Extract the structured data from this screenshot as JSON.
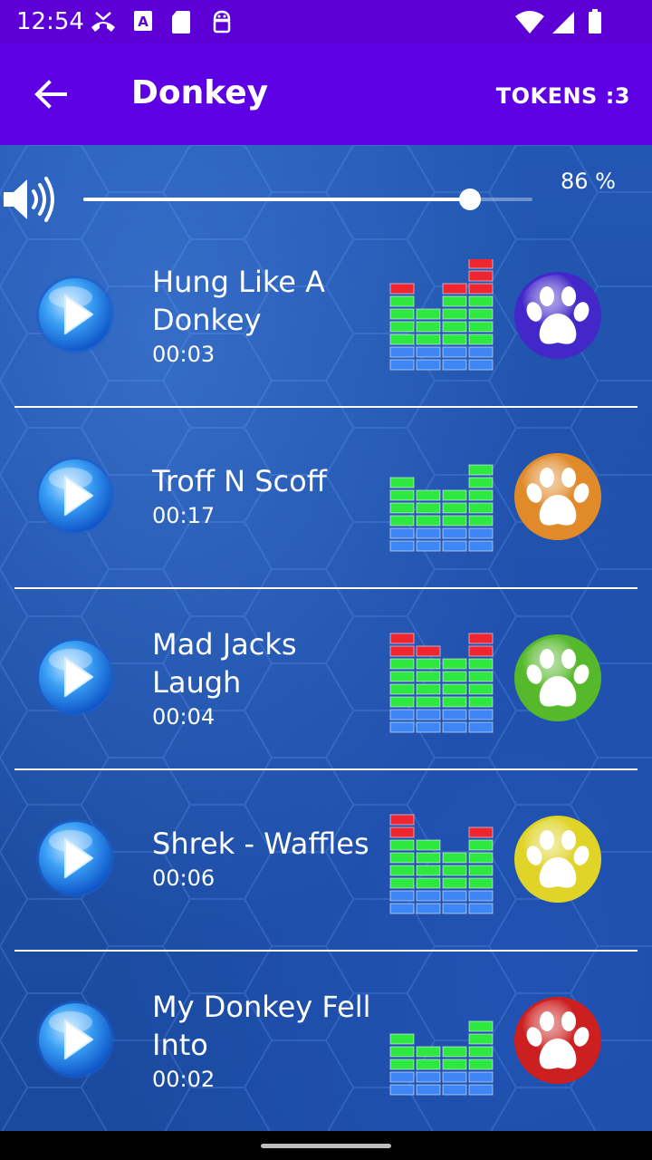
{
  "status": {
    "time": "12:54",
    "icons": [
      "missed-call-icon",
      "text-a-icon",
      "sd-card-icon",
      "android-icon"
    ],
    "right_icons": [
      "wifi-icon",
      "signal-icon",
      "battery-icon"
    ]
  },
  "app_bar": {
    "title": "Donkey",
    "tokens": "TOKENS :3",
    "back_icon": "arrow-back-icon",
    "color": "#5d00e3"
  },
  "volume": {
    "percent_label": "86 %",
    "level": 0.86,
    "icon": "speaker-icon"
  },
  "sounds": [
    {
      "title": "Hung Like A Donkey",
      "duration": "00:03",
      "paw_color": "#4327c9",
      "eq": [
        {
          "g": 4,
          "r": 1
        },
        {
          "g": 3,
          "r": 0
        },
        {
          "g": 4,
          "r": 1
        },
        {
          "g": 4,
          "r": 3
        }
      ]
    },
    {
      "title": "Troff N Scoff",
      "duration": "00:17",
      "paw_color": "#e08a2a",
      "eq": [
        {
          "g": 4,
          "r": 0
        },
        {
          "g": 3,
          "r": 0
        },
        {
          "g": 3,
          "r": 0
        },
        {
          "g": 5,
          "r": 0
        }
      ]
    },
    {
      "title": "Mad Jacks Laugh",
      "duration": "00:04",
      "paw_color": "#56b82b",
      "eq": [
        {
          "g": 4,
          "r": 2
        },
        {
          "g": 4,
          "r": 1
        },
        {
          "g": 4,
          "r": 0
        },
        {
          "g": 4,
          "r": 2
        }
      ]
    },
    {
      "title": "Shrek - Waffles",
      "duration": "00:06",
      "paw_color": "#dfd427",
      "eq": [
        {
          "g": 4,
          "r": 2
        },
        {
          "g": 4,
          "r": 0
        },
        {
          "g": 3,
          "r": 0
        },
        {
          "g": 4,
          "r": 1
        }
      ]
    },
    {
      "title": "My Donkey Fell Into",
      "duration": "00:02",
      "paw_color": "#cc1f1f",
      "eq": [
        {
          "g": 3,
          "r": 0
        },
        {
          "g": 2,
          "r": 0
        },
        {
          "g": 2,
          "r": 0
        },
        {
          "g": 4,
          "r": 0
        }
      ]
    }
  ],
  "colors": {
    "eq_blue": "#3c86f6",
    "eq_green": "#2fe83f",
    "eq_red": "#ef2530",
    "background": "#1d4fa6"
  }
}
